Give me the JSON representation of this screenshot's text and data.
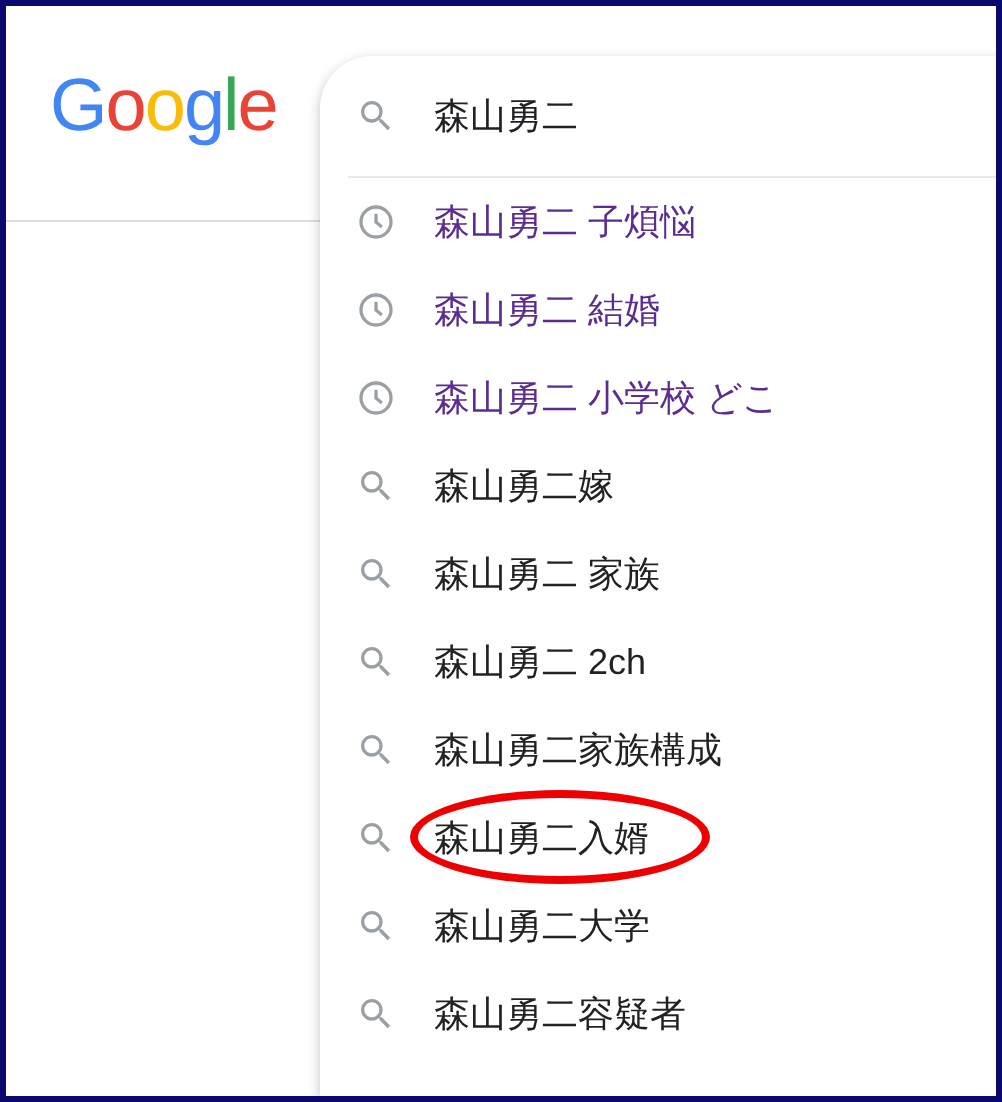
{
  "logo": [
    {
      "letter": "G",
      "color": "#4285f4"
    },
    {
      "letter": "o",
      "color": "#ea4335"
    },
    {
      "letter": "o",
      "color": "#fbbc05"
    },
    {
      "letter": "g",
      "color": "#4285f4"
    },
    {
      "letter": "l",
      "color": "#34a853"
    },
    {
      "letter": "e",
      "color": "#ea4335"
    }
  ],
  "search": {
    "value": "森山勇二"
  },
  "suggestions": [
    {
      "kind": "history",
      "text": "森山勇二 子煩悩",
      "circled": false
    },
    {
      "kind": "history",
      "text": "森山勇二 結婚",
      "circled": false
    },
    {
      "kind": "history",
      "text": "森山勇二 小学校 どこ",
      "circled": false
    },
    {
      "kind": "search",
      "text": "森山勇二嫁",
      "circled": false
    },
    {
      "kind": "search",
      "text": "森山勇二 家族",
      "circled": false
    },
    {
      "kind": "search",
      "text": "森山勇二 2ch",
      "circled": false
    },
    {
      "kind": "search",
      "text": "森山勇二家族構成",
      "circled": false
    },
    {
      "kind": "search",
      "text": "森山勇二入婿",
      "circled": true
    },
    {
      "kind": "search",
      "text": "森山勇二大学",
      "circled": false
    },
    {
      "kind": "search",
      "text": "森山勇二容疑者",
      "circled": false
    }
  ]
}
